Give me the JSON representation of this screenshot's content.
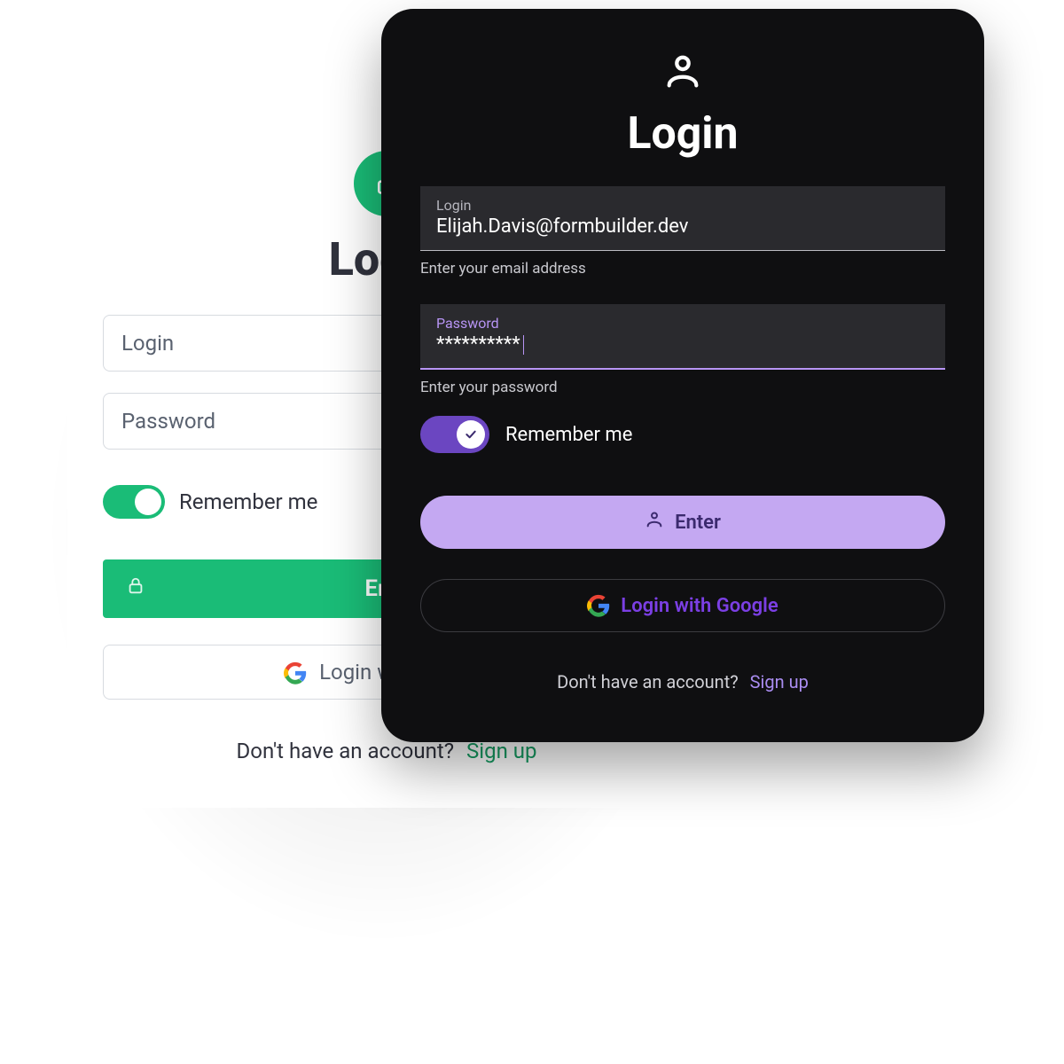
{
  "light": {
    "title": "Login",
    "login_placeholder": "Login",
    "password_placeholder": "Password",
    "remember_label": "Remember me",
    "enter_label": "Enter",
    "google_label": "Login with Google",
    "signup_prompt": "Don't have an account?",
    "signup_link": "Sign up",
    "remember_on": true,
    "accent": "#1abc77"
  },
  "dark": {
    "title": "Login",
    "login_label": "Login",
    "login_value": "Elijah.Davis@formbuilder.dev",
    "login_hint": "Enter your email address",
    "password_label": "Password",
    "password_value": "**********",
    "password_hint": "Enter your password",
    "remember_label": "Remember me",
    "enter_label": "Enter",
    "google_label": "Login with Google",
    "signup_prompt": "Don't have an account?",
    "signup_link": "Sign up",
    "remember_on": true,
    "accent": "#6b46c1"
  }
}
